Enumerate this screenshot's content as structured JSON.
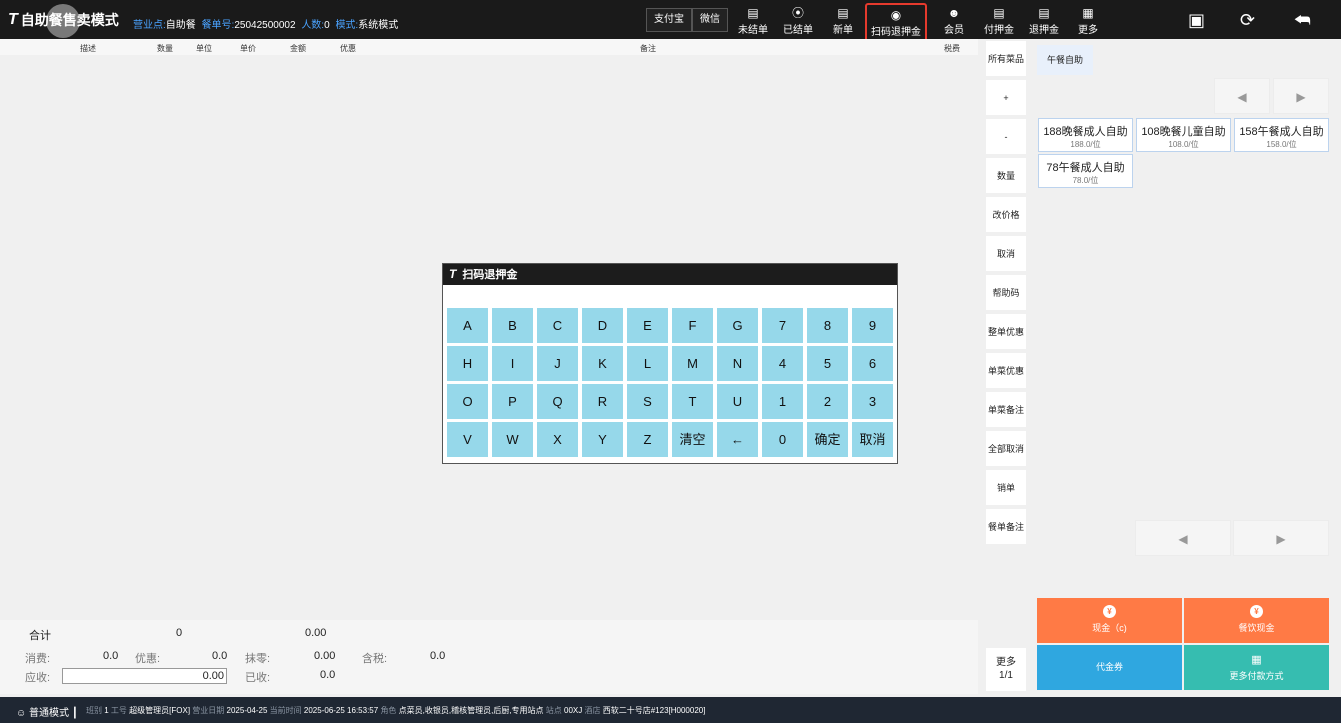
{
  "header": {
    "logo": "T",
    "title": "自助餐售卖模式",
    "meta": [
      {
        "label": "营业点:",
        "value": "自助餐"
      },
      {
        "label": "餐单号:",
        "value": "25042500002"
      },
      {
        "label": "人数:",
        "value": "0"
      },
      {
        "label": "模式:",
        "value": "系统模式"
      }
    ],
    "pay_buttons": [
      "支付宝",
      "微信"
    ],
    "tools": [
      {
        "label": "未结单",
        "icon": "document-icon"
      },
      {
        "label": "已结单",
        "icon": "checked-circle-icon"
      },
      {
        "label": "新单",
        "icon": "new-document-icon"
      },
      {
        "label": "扫码退押金",
        "icon": "scan-icon"
      },
      {
        "label": "会员",
        "icon": "member-icon"
      },
      {
        "label": "付押金",
        "icon": "document-icon"
      },
      {
        "label": "退押金",
        "icon": "document-icon"
      },
      {
        "label": "更多",
        "icon": "grid-icon"
      }
    ],
    "right_icons": [
      "lock-icon",
      "refresh-icon",
      "return-icon"
    ]
  },
  "table": {
    "columns": [
      "描述",
      "数量",
      "单位",
      "单价",
      "金额",
      "优惠",
      "备注",
      "税费"
    ]
  },
  "totals": {
    "label": "合计",
    "qty": "0",
    "amount": "0.00",
    "fee_label": "消费:",
    "fee": "0.0",
    "discount_label": "优惠:",
    "discount": "0.0",
    "rounding_label": "抹零:",
    "rounding": "0.00",
    "tax_label": "含税:",
    "tax": "0.0",
    "due_label": "应收:",
    "due": "0.00",
    "received_label": "已收:",
    "received": "0.0"
  },
  "status": {
    "mode": "普通模式",
    "shift_label": "班别",
    "shift": "1",
    "staff_label": "工号",
    "staff": "超级管理员[FOX]",
    "bizdate_label": "营业日期",
    "bizdate": "2025-04-25",
    "now_label": "当前时间",
    "now": "2025-06-25 16:53:57",
    "role_label": "角色",
    "role": "点菜员,收银员,稽核管理员,后厨,专用站点",
    "station_label": "站点",
    "station": "00XJ",
    "store_label": "酒店",
    "store": "西软二十号店#123[H000020]"
  },
  "functions": [
    "所有菜品",
    "+",
    "-",
    "数量",
    "改价格",
    "取消",
    "帮助码",
    "整单优惠",
    "单菜优惠",
    "单菜备注",
    "全部取消",
    "销单",
    "餐单备注"
  ],
  "more": {
    "label": "更多",
    "page": "1/1"
  },
  "menu": {
    "category": "午餐自助",
    "dishes": [
      {
        "name": "188晚餐成人自助",
        "price": "188.0/位"
      },
      {
        "name": "108晚餐儿童自助",
        "price": "108.0/位"
      },
      {
        "name": "158午餐成人自助",
        "price": "158.0/位"
      },
      {
        "name": "78午餐成人自助",
        "price": "78.0/位"
      }
    ],
    "nav_prev": "◀",
    "nav_next": "▶"
  },
  "payments": [
    {
      "label": "现金（c)",
      "color": "#ff7a45"
    },
    {
      "label": "餐饮现金",
      "color": "#ff7a45"
    },
    {
      "label": "代金券",
      "color": "#2fa7e0"
    },
    {
      "label": "更多付款方式",
      "color": "#36bdb0"
    }
  ],
  "dialog": {
    "title": "扫码退押金",
    "input_value": "",
    "keys": [
      [
        "A",
        "B",
        "C",
        "D",
        "E",
        "F",
        "G",
        "7",
        "8",
        "9"
      ],
      [
        "H",
        "I",
        "J",
        "K",
        "L",
        "M",
        "N",
        "4",
        "5",
        "6"
      ],
      [
        "O",
        "P",
        "Q",
        "R",
        "S",
        "T",
        "U",
        "1",
        "2",
        "3"
      ],
      [
        "V",
        "W",
        "X",
        "Y",
        "Z",
        "清空",
        "←",
        "0",
        "确定",
        "取消"
      ]
    ]
  }
}
